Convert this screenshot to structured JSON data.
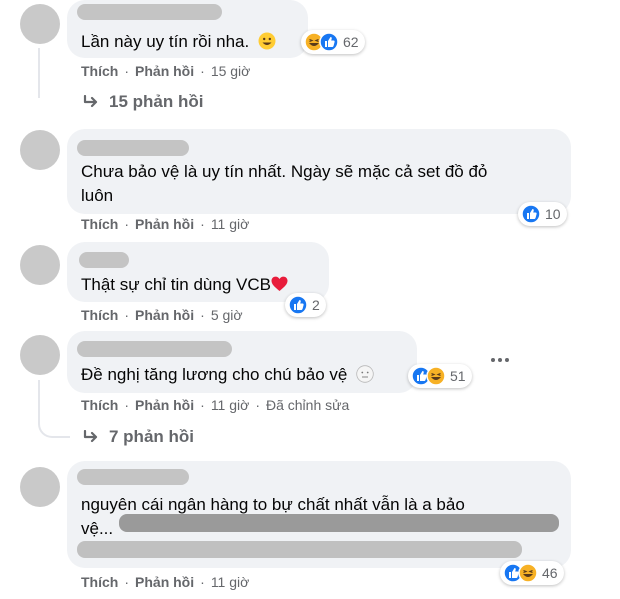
{
  "comments": [
    {
      "text": "Lần này uy tín rồi nha.",
      "emoji": "grinning-face",
      "reactions": [
        "haha",
        "like"
      ],
      "reaction_count": "62",
      "like_label": "Thích",
      "reply_label": "Phản hồi",
      "time": "15 giờ",
      "replies_label": "15 phản hồi"
    },
    {
      "text_line1": "Chưa bảo vệ là uy tín nhất. Ngày sẽ mặc cả set đồ đỏ",
      "text_line2": "luôn",
      "reactions": [
        "like"
      ],
      "reaction_count": "10",
      "like_label": "Thích",
      "reply_label": "Phản hồi",
      "time": "11 giờ"
    },
    {
      "text": "Thật sự chỉ tin dùng VCB",
      "emoji": "red-heart",
      "reactions": [
        "like"
      ],
      "reaction_count": "2",
      "like_label": "Thích",
      "reply_label": "Phản hồi",
      "time": "5 giờ"
    },
    {
      "text": "Đề nghị tăng lương cho chú bảo vệ",
      "emoji": "neutral-face",
      "reactions": [
        "like",
        "haha"
      ],
      "reaction_count": "51",
      "like_label": "Thích",
      "reply_label": "Phản hồi",
      "time": "11 giờ",
      "edited_label": "Đã chỉnh sửa",
      "replies_label": "7 phản hồi"
    },
    {
      "text_line1": "nguyên cái ngân hàng to bự chất nhất vẫn là a bảo",
      "text_line2": "vệ...",
      "reactions": [
        "like",
        "haha"
      ],
      "reaction_count": "46",
      "like_label": "Thích",
      "reply_label": "Phản hồi",
      "time": "11 giờ"
    }
  ],
  "separator": "·",
  "colors": {
    "bubble": "#f0f2f5",
    "secondary_text": "#65676b",
    "like_blue": "#1877f2",
    "haha_yellow": "#f7b125",
    "heart_red": "#f33e58"
  }
}
